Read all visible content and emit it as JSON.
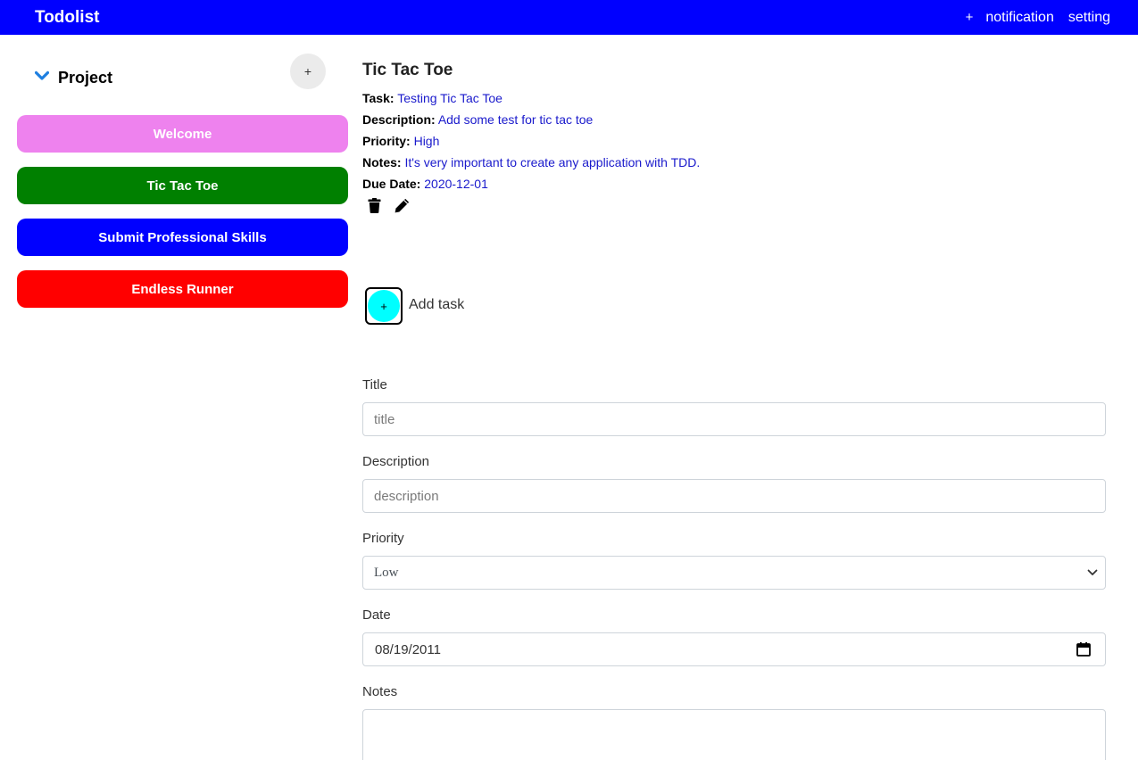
{
  "navbar": {
    "brand": "Todolist",
    "add_label": "+",
    "notification_label": "notification",
    "setting_label": "setting",
    "color": "#0000ff"
  },
  "sidebar": {
    "project_heading": "Project",
    "add_project_label": "+",
    "projects": [
      {
        "label": "Welcome",
        "color": "#ee82ee"
      },
      {
        "label": "Tic Tac Toe",
        "color": "#008000"
      },
      {
        "label": "Submit Professional Skills",
        "color": "#0000ff"
      },
      {
        "label": "Endless Runner",
        "color": "#ff0000"
      }
    ]
  },
  "task": {
    "title": "Tic Tac Toe",
    "task_key": "Task:",
    "task_value": "Testing Tic Tac Toe",
    "description_key": "Description:",
    "description_value": "Add some test for tic tac toe",
    "priority_key": "Priority:",
    "priority_value": "High",
    "notes_key": "Notes:",
    "notes_value": "It's very important to create any application with TDD.",
    "due_key": "Due Date:",
    "due_value": "2020-12-01",
    "delete_icon": "trash-icon",
    "edit_icon": "pencil-icon"
  },
  "add_task": {
    "button_label": "+",
    "label": "Add task",
    "color": "#00ffff"
  },
  "form": {
    "title_label": "Title",
    "title_placeholder": "title",
    "description_label": "Description",
    "description_placeholder": "description",
    "priority_label": "Priority",
    "priority_value": "Low",
    "date_label": "Date",
    "date_value": "08/19/2011",
    "notes_label": "Notes"
  }
}
